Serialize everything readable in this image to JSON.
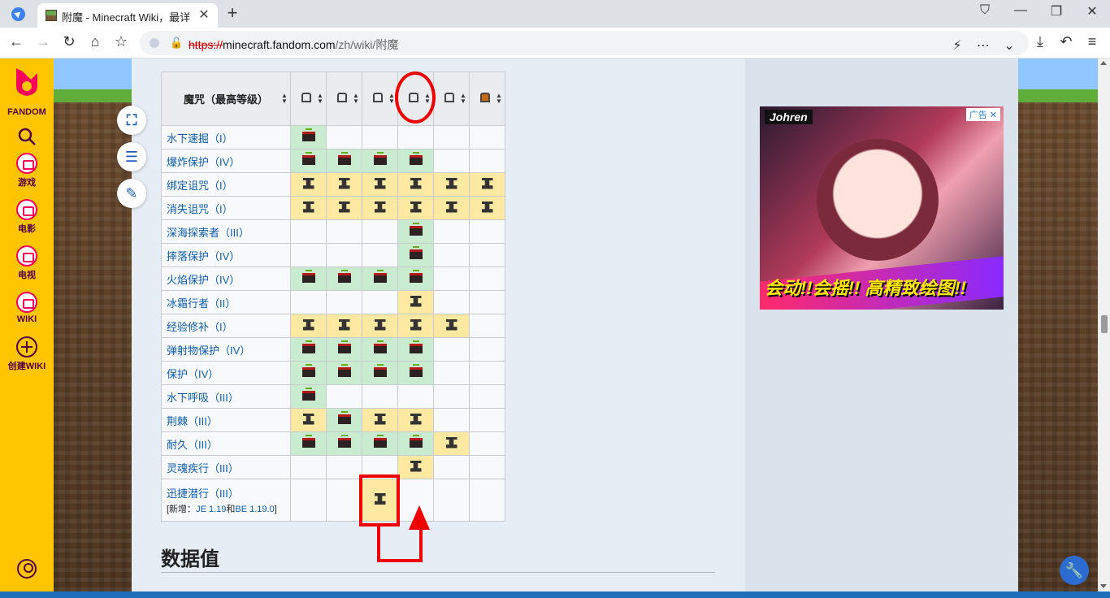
{
  "browser": {
    "tab_title": "附魔 - Minecraft Wiki，最详",
    "url_scheme": "https://",
    "url_host": "minecraft.fandom.com",
    "url_path": "/zh/wiki/附魔"
  },
  "sidebar": {
    "brand": "FANDOM",
    "items": [
      {
        "label": "游戏",
        "icon": "gamepad-icon"
      },
      {
        "label": "电影",
        "icon": "film-icon"
      },
      {
        "label": "电视",
        "icon": "tv-icon"
      },
      {
        "label": "WIKI",
        "icon": "book-icon"
      },
      {
        "label": "创建WIKI",
        "icon": "plus-circle-icon"
      }
    ]
  },
  "table": {
    "header": "魔咒（最高等级）",
    "columns": [
      "helmet",
      "chestplate",
      "leggings",
      "boots",
      "turtle-shell",
      "pumpkin-head"
    ],
    "rows": [
      {
        "name": "水下速掘（I）",
        "cells": [
          "g",
          "",
          "",
          "",
          "",
          ""
        ]
      },
      {
        "name": "爆炸保护（IV）",
        "cells": [
          "g",
          "g",
          "g",
          "g",
          "",
          ""
        ]
      },
      {
        "name": "绑定诅咒（I）",
        "cells": [
          "y",
          "y",
          "y",
          "y",
          "y",
          "y"
        ]
      },
      {
        "name": "消失诅咒（I）",
        "cells": [
          "y",
          "y",
          "y",
          "y",
          "y",
          "y"
        ]
      },
      {
        "name": "深海探索者（III）",
        "cells": [
          "",
          "",
          "",
          "g",
          "",
          ""
        ]
      },
      {
        "name": "摔落保护（IV）",
        "cells": [
          "",
          "",
          "",
          "g",
          "",
          ""
        ]
      },
      {
        "name": "火焰保护（IV）",
        "cells": [
          "g",
          "g",
          "g",
          "g",
          "",
          ""
        ]
      },
      {
        "name": "冰霜行者（II）",
        "cells": [
          "",
          "",
          "",
          "y",
          "",
          ""
        ]
      },
      {
        "name": "经验修补（I）",
        "cells": [
          "y",
          "y",
          "y",
          "y",
          "y",
          ""
        ]
      },
      {
        "name": "弹射物保护（IV）",
        "cells": [
          "g",
          "g",
          "g",
          "g",
          "",
          ""
        ]
      },
      {
        "name": "保护（IV）",
        "cells": [
          "g",
          "g",
          "g",
          "g",
          "",
          ""
        ]
      },
      {
        "name": "水下呼吸（III）",
        "cells": [
          "g",
          "",
          "",
          "",
          "",
          ""
        ]
      },
      {
        "name": "荆棘（III）",
        "cells": [
          "y",
          "g",
          "y",
          "y",
          "",
          ""
        ]
      },
      {
        "name": "耐久（III）",
        "cells": [
          "g",
          "g",
          "g",
          "g",
          "y",
          ""
        ]
      },
      {
        "name": "灵魂疾行（III）",
        "cells": [
          "",
          "",
          "",
          "y",
          "",
          ""
        ]
      },
      {
        "name": "迅捷潜行（III）",
        "sub_prefix": "[新增：",
        "sub_link1": "JE 1.19",
        "sub_mid": "和",
        "sub_link2": "BE 1.19.0",
        "sub_suffix": "]",
        "cells": [
          "",
          "",
          "y",
          "",
          "",
          ""
        ]
      }
    ]
  },
  "section_heading": "数据值",
  "ad": {
    "brand": "Johren",
    "badge": "广告",
    "slogan": "会动!!会摇!! 高精致绘图!!"
  },
  "colors": {
    "fandom_yellow": "#ffc500",
    "green_cell": "#c9ecd0",
    "yellow_cell": "#fde9a2",
    "annotation_red": "#e00000"
  }
}
